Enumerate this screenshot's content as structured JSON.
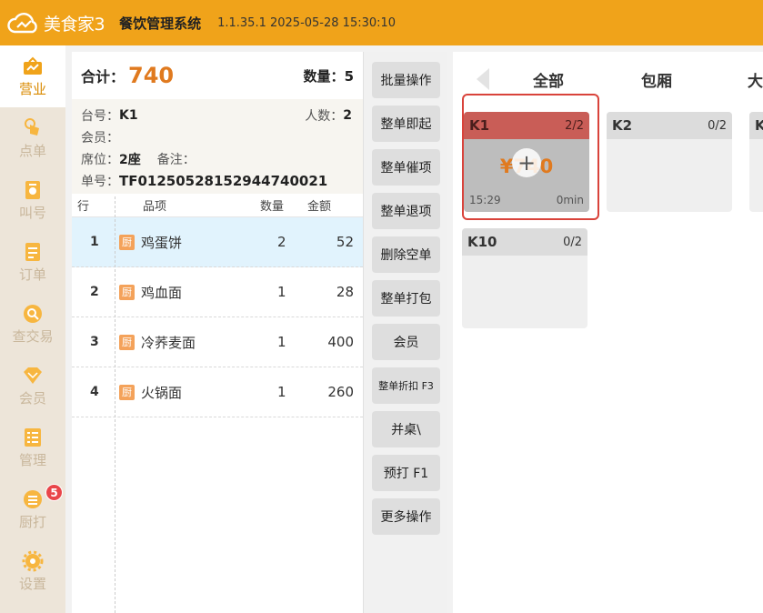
{
  "header": {
    "brand": "美食家3",
    "system_title": "餐饮管理系统",
    "version_time": "1.1.35.1 2025-05-28 15:30:10"
  },
  "sidebar": {
    "items": [
      {
        "label": "营业",
        "icon": "business-icon",
        "active": true
      },
      {
        "label": "点单",
        "icon": "tap-order-icon",
        "active": false
      },
      {
        "label": "叫号",
        "icon": "call-number-icon",
        "active": false
      },
      {
        "label": "订单",
        "icon": "orders-icon",
        "active": false
      },
      {
        "label": "查交易",
        "icon": "search-transaction-icon",
        "active": false
      },
      {
        "label": "会员",
        "icon": "diamond-member-icon",
        "active": false
      },
      {
        "label": "管理",
        "icon": "manage-list-icon",
        "active": false
      },
      {
        "label": "厨打",
        "icon": "kitchen-print-icon",
        "active": false
      },
      {
        "label": "设置",
        "icon": "gear-icon",
        "active": false
      }
    ],
    "kitchen_badge": "5"
  },
  "order": {
    "total_label": "合计：",
    "total_value": "740",
    "qty_label": "数量：",
    "qty_value": "5",
    "table_label": "台号：",
    "table_value": "K1",
    "people_label": "人数：",
    "people_value": "2",
    "member_label": "会员：",
    "seat_label": "席位：",
    "seat_value": "2座",
    "remark_label": "备注：",
    "no_label": "单号：",
    "no_value": "TF01250528152944740021",
    "columns": {
      "row": "行",
      "item": "品项",
      "qty": "数量",
      "amount": "金额"
    },
    "kitchen_tag": "厨",
    "rows": [
      {
        "idx": "1",
        "name": "鸡蛋饼",
        "qty": "2",
        "amount": "52"
      },
      {
        "idx": "2",
        "name": "鸡血面",
        "qty": "1",
        "amount": "28"
      },
      {
        "idx": "3",
        "name": "冷荞麦面",
        "qty": "1",
        "amount": "400"
      },
      {
        "idx": "4",
        "name": "火锅面",
        "qty": "1",
        "amount": "260"
      }
    ]
  },
  "actions": [
    "批量操作",
    "整单即起",
    "整单催项",
    "整单退项",
    "删除空单",
    "整单打包",
    "会员",
    "整单折扣 F3",
    "并桌\\",
    "预打 F1",
    "更多操作"
  ],
  "tables": {
    "tabs": [
      "全部",
      "包厢",
      "大"
    ],
    "cards": [
      {
        "name": "K1",
        "count": "2/2",
        "amount": "¥740",
        "time": "15:29",
        "duration": "0min",
        "busy": true
      },
      {
        "name": "K2",
        "count": "0/2",
        "busy": false
      },
      {
        "name": "K",
        "count": "",
        "busy": false
      },
      {
        "name": "K10",
        "count": "0/2",
        "busy": false
      }
    ]
  },
  "colors": {
    "header": "#f0a31a",
    "accent": "#e07a1f",
    "busy_card": "#c95d57",
    "highlight": "#d9433b"
  }
}
